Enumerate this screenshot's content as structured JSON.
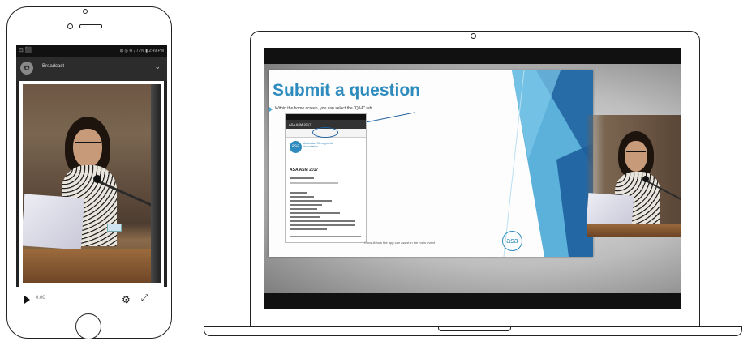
{
  "phone": {
    "status_left": "⊡ ⬛",
    "status_right": "⊠ ◎ ⊕ ᵢₗ 77% ▮ 2:49 PM",
    "app_logo": "✿",
    "app_title": "Broadcast",
    "menu_icon": "⌄",
    "video": {
      "time": "0:00",
      "play_icon": "play-icon",
      "settings_icon": "gear-icon",
      "fullscreen_icon": "fullscreen-icon"
    }
  },
  "laptop": {
    "slide": {
      "title": "Submit a question",
      "bullet": "Within the home screen, you can select the \"Q&A\" tab",
      "app_header": "ASA ASM 2017",
      "logo_text": "asa",
      "logo_name": "Australian Stenographic Association",
      "app_heading": "ASA ASM 2017",
      "caption": "Consult how the app can assist in the main event",
      "brand_logo": "asa"
    }
  },
  "colors": {
    "accent": "#2e8bbd",
    "slide_dark_blue": "#1e5f9e",
    "slide_light_blue": "#49a9d6"
  }
}
